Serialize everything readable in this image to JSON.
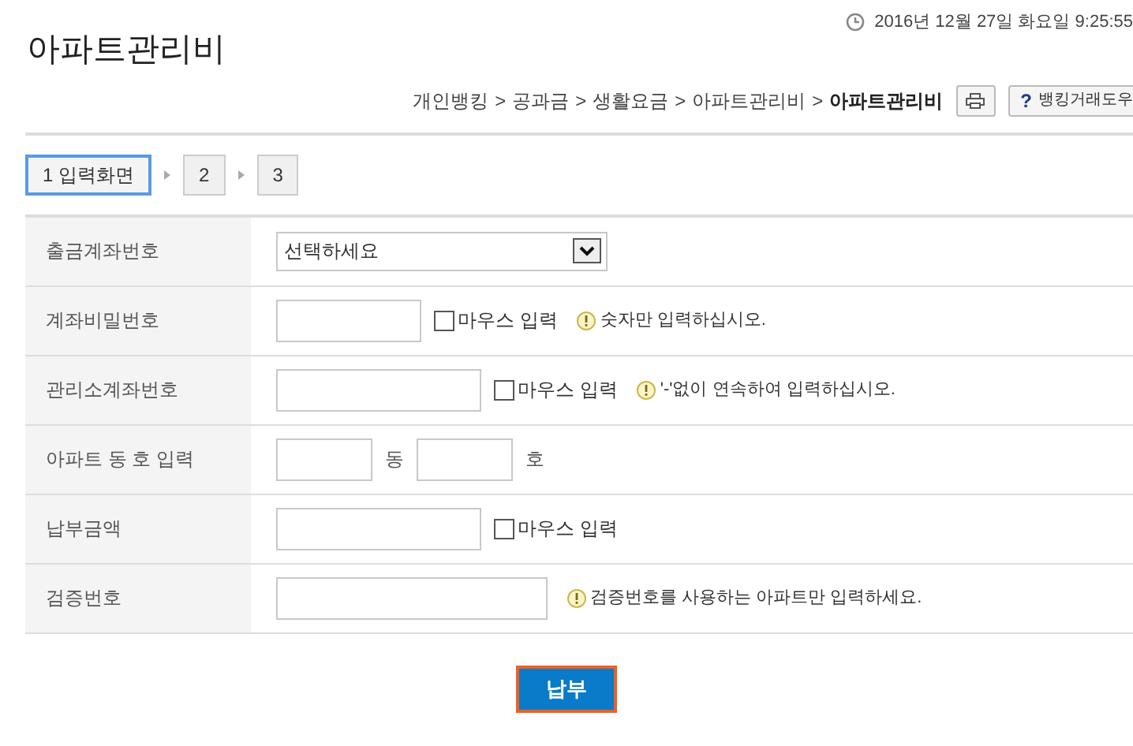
{
  "datetime": "2016년 12월 27일 화요일 9:25:55",
  "title": "아파트관리비",
  "breadcrumb": [
    "개인뱅킹",
    "공과금",
    "생활요금",
    "아파트관리비"
  ],
  "breadcrumb_separator": ">",
  "breadcrumb_current": "아파트관리비",
  "help_button": {
    "icon": "?",
    "label": "뱅킹거래도우"
  },
  "steps": [
    {
      "label": "1 입력화면",
      "selected": true
    },
    {
      "label": "2",
      "selected": false
    },
    {
      "label": "3",
      "selected": false
    }
  ],
  "rows": [
    {
      "label": "출금계좌번호",
      "controls": [
        {
          "kind": "select",
          "value": "선택하세요"
        }
      ]
    },
    {
      "label": "계좌비밀번호",
      "controls": [
        {
          "kind": "password"
        },
        {
          "kind": "checkbox",
          "label": "마우스 입력",
          "checked": false
        },
        {
          "kind": "hint",
          "text": "숫자만 입력하십시오."
        }
      ]
    },
    {
      "label": "관리소계좌번호",
      "controls": [
        {
          "kind": "account"
        },
        {
          "kind": "checkbox",
          "label": "마우스 입력",
          "checked": false
        },
        {
          "kind": "hint",
          "text": "'-'없이 연속하여 입력하십시오."
        }
      ]
    },
    {
      "label": "아파트 동 호 입력",
      "controls": [
        {
          "kind": "number"
        },
        {
          "kind": "unit",
          "text": "동"
        },
        {
          "kind": "number"
        },
        {
          "kind": "unit",
          "text": "호"
        }
      ]
    },
    {
      "label": "납부금액",
      "controls": [
        {
          "kind": "amount"
        },
        {
          "kind": "checkbox",
          "label": "마우스 입력",
          "checked": false
        }
      ]
    },
    {
      "label": "검증번호",
      "controls": [
        {
          "kind": "code"
        },
        {
          "kind": "hint",
          "text": "검증번호를 사용하는 아파트만 입력하세요."
        }
      ]
    }
  ],
  "submit": "납부"
}
